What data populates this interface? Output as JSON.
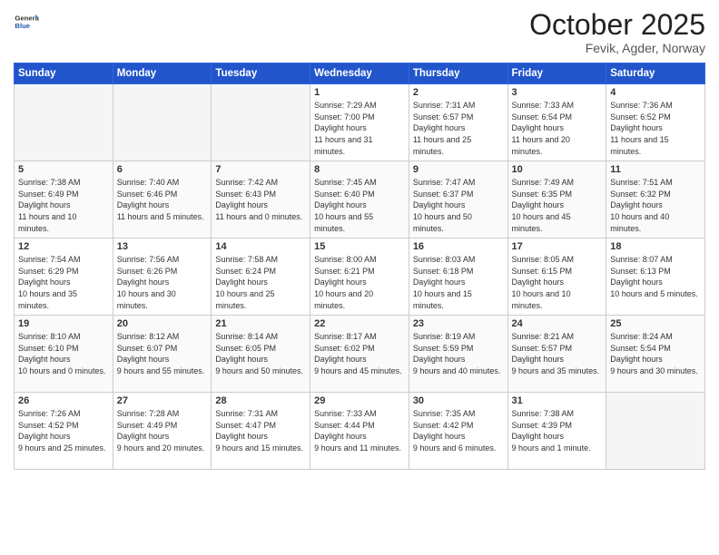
{
  "logo": {
    "general": "General",
    "blue": "Blue"
  },
  "header": {
    "month": "October 2025",
    "location": "Fevik, Agder, Norway"
  },
  "weekdays": [
    "Sunday",
    "Monday",
    "Tuesday",
    "Wednesday",
    "Thursday",
    "Friday",
    "Saturday"
  ],
  "weeks": [
    [
      {
        "day": "",
        "empty": true
      },
      {
        "day": "",
        "empty": true
      },
      {
        "day": "",
        "empty": true
      },
      {
        "day": "1",
        "sunrise": "7:29 AM",
        "sunset": "7:00 PM",
        "daylight": "11 hours and 31 minutes."
      },
      {
        "day": "2",
        "sunrise": "7:31 AM",
        "sunset": "6:57 PM",
        "daylight": "11 hours and 25 minutes."
      },
      {
        "day": "3",
        "sunrise": "7:33 AM",
        "sunset": "6:54 PM",
        "daylight": "11 hours and 20 minutes."
      },
      {
        "day": "4",
        "sunrise": "7:36 AM",
        "sunset": "6:52 PM",
        "daylight": "11 hours and 15 minutes."
      }
    ],
    [
      {
        "day": "5",
        "sunrise": "7:38 AM",
        "sunset": "6:49 PM",
        "daylight": "11 hours and 10 minutes."
      },
      {
        "day": "6",
        "sunrise": "7:40 AM",
        "sunset": "6:46 PM",
        "daylight": "11 hours and 5 minutes."
      },
      {
        "day": "7",
        "sunrise": "7:42 AM",
        "sunset": "6:43 PM",
        "daylight": "11 hours and 0 minutes."
      },
      {
        "day": "8",
        "sunrise": "7:45 AM",
        "sunset": "6:40 PM",
        "daylight": "10 hours and 55 minutes."
      },
      {
        "day": "9",
        "sunrise": "7:47 AM",
        "sunset": "6:37 PM",
        "daylight": "10 hours and 50 minutes."
      },
      {
        "day": "10",
        "sunrise": "7:49 AM",
        "sunset": "6:35 PM",
        "daylight": "10 hours and 45 minutes."
      },
      {
        "day": "11",
        "sunrise": "7:51 AM",
        "sunset": "6:32 PM",
        "daylight": "10 hours and 40 minutes."
      }
    ],
    [
      {
        "day": "12",
        "sunrise": "7:54 AM",
        "sunset": "6:29 PM",
        "daylight": "10 hours and 35 minutes."
      },
      {
        "day": "13",
        "sunrise": "7:56 AM",
        "sunset": "6:26 PM",
        "daylight": "10 hours and 30 minutes."
      },
      {
        "day": "14",
        "sunrise": "7:58 AM",
        "sunset": "6:24 PM",
        "daylight": "10 hours and 25 minutes."
      },
      {
        "day": "15",
        "sunrise": "8:00 AM",
        "sunset": "6:21 PM",
        "daylight": "10 hours and 20 minutes."
      },
      {
        "day": "16",
        "sunrise": "8:03 AM",
        "sunset": "6:18 PM",
        "daylight": "10 hours and 15 minutes."
      },
      {
        "day": "17",
        "sunrise": "8:05 AM",
        "sunset": "6:15 PM",
        "daylight": "10 hours and 10 minutes."
      },
      {
        "day": "18",
        "sunrise": "8:07 AM",
        "sunset": "6:13 PM",
        "daylight": "10 hours and 5 minutes."
      }
    ],
    [
      {
        "day": "19",
        "sunrise": "8:10 AM",
        "sunset": "6:10 PM",
        "daylight": "10 hours and 0 minutes."
      },
      {
        "day": "20",
        "sunrise": "8:12 AM",
        "sunset": "6:07 PM",
        "daylight": "9 hours and 55 minutes."
      },
      {
        "day": "21",
        "sunrise": "8:14 AM",
        "sunset": "6:05 PM",
        "daylight": "9 hours and 50 minutes."
      },
      {
        "day": "22",
        "sunrise": "8:17 AM",
        "sunset": "6:02 PM",
        "daylight": "9 hours and 45 minutes."
      },
      {
        "day": "23",
        "sunrise": "8:19 AM",
        "sunset": "5:59 PM",
        "daylight": "9 hours and 40 minutes."
      },
      {
        "day": "24",
        "sunrise": "8:21 AM",
        "sunset": "5:57 PM",
        "daylight": "9 hours and 35 minutes."
      },
      {
        "day": "25",
        "sunrise": "8:24 AM",
        "sunset": "5:54 PM",
        "daylight": "9 hours and 30 minutes."
      }
    ],
    [
      {
        "day": "26",
        "sunrise": "7:26 AM",
        "sunset": "4:52 PM",
        "daylight": "9 hours and 25 minutes."
      },
      {
        "day": "27",
        "sunrise": "7:28 AM",
        "sunset": "4:49 PM",
        "daylight": "9 hours and 20 minutes."
      },
      {
        "day": "28",
        "sunrise": "7:31 AM",
        "sunset": "4:47 PM",
        "daylight": "9 hours and 15 minutes."
      },
      {
        "day": "29",
        "sunrise": "7:33 AM",
        "sunset": "4:44 PM",
        "daylight": "9 hours and 11 minutes."
      },
      {
        "day": "30",
        "sunrise": "7:35 AM",
        "sunset": "4:42 PM",
        "daylight": "9 hours and 6 minutes."
      },
      {
        "day": "31",
        "sunrise": "7:38 AM",
        "sunset": "4:39 PM",
        "daylight": "9 hours and 1 minute."
      },
      {
        "day": "",
        "empty": true
      }
    ]
  ],
  "labels": {
    "sunrise": "Sunrise:",
    "sunset": "Sunset:",
    "daylight": "Daylight hours"
  }
}
